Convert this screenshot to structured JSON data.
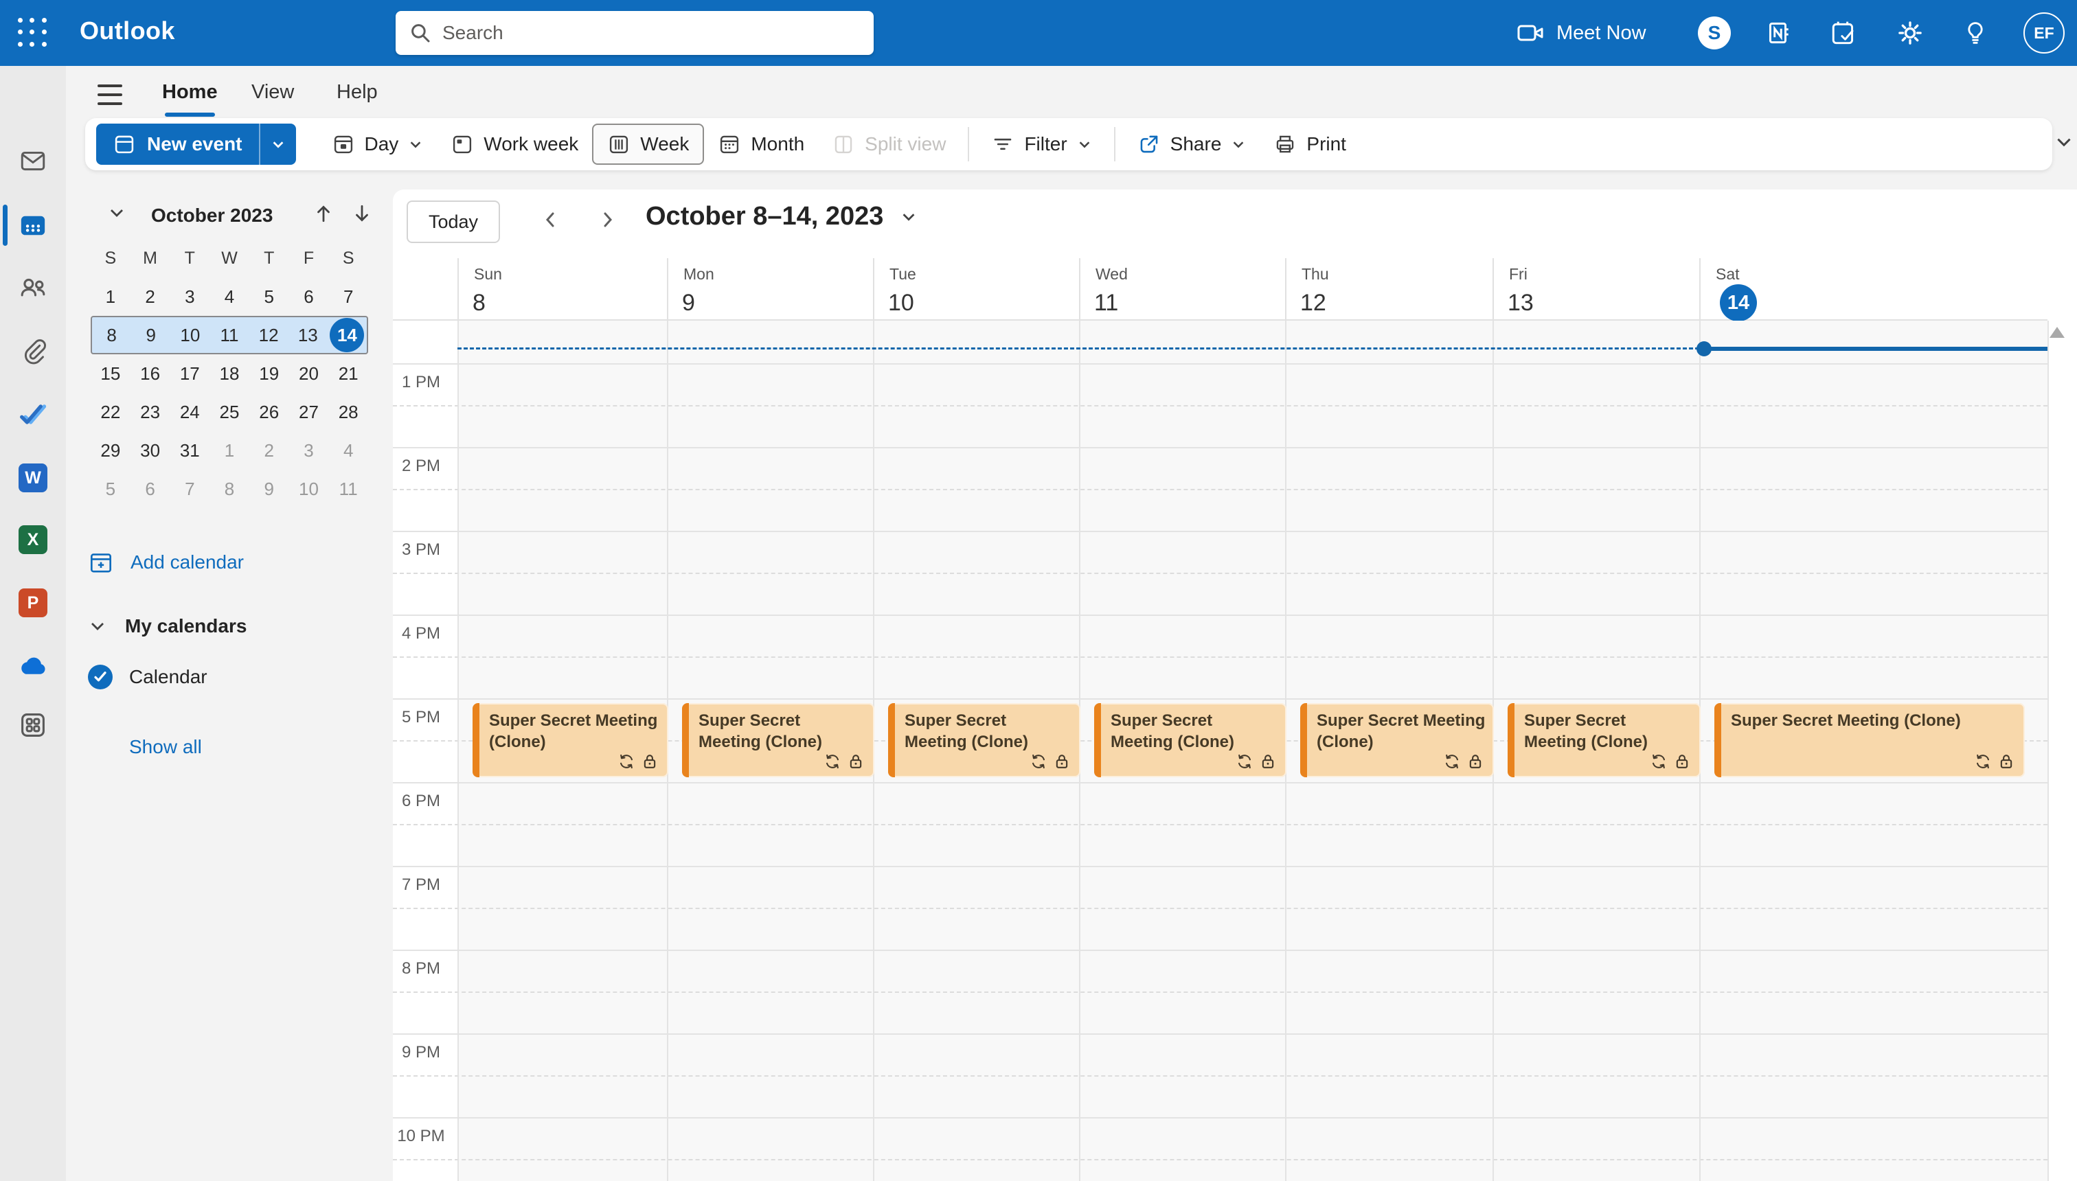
{
  "colors": {
    "accent": "#0f6cbd",
    "topbar": "#0f6cbd",
    "event_fill": "#f8d8ab",
    "event_bar": "#e9831d",
    "now_line": "#1266ab"
  },
  "topbar": {
    "app_name": "Outlook",
    "search_placeholder": "Search",
    "meet_now_label": "Meet Now",
    "avatar_initials": "EF"
  },
  "rail": {
    "items": [
      {
        "id": "mail"
      },
      {
        "id": "calendar",
        "selected": true
      },
      {
        "id": "people"
      },
      {
        "id": "attachments"
      },
      {
        "id": "todo"
      },
      {
        "id": "word"
      },
      {
        "id": "excel"
      },
      {
        "id": "powerpoint"
      },
      {
        "id": "onedrive"
      },
      {
        "id": "apps"
      }
    ],
    "office_letters": {
      "word": "W",
      "excel": "X",
      "powerpoint": "P"
    }
  },
  "ribbon": {
    "tabs": [
      {
        "label": "Home",
        "active": true
      },
      {
        "label": "View",
        "active": false
      },
      {
        "label": "Help",
        "active": false
      }
    ],
    "new_event_label": "New event",
    "view_buttons": [
      {
        "label": "Day",
        "chevron": true
      },
      {
        "label": "Work week"
      },
      {
        "label": "Week",
        "selected": true
      },
      {
        "label": "Month"
      },
      {
        "label": "Split view",
        "disabled": true
      }
    ],
    "filter_label": "Filter",
    "share_label": "Share",
    "print_label": "Print"
  },
  "sidebar": {
    "month_title": "October 2023",
    "weekdays": [
      "S",
      "M",
      "T",
      "W",
      "T",
      "F",
      "S"
    ],
    "weeks": [
      [
        {
          "d": 1
        },
        {
          "d": 2
        },
        {
          "d": 3
        },
        {
          "d": 4
        },
        {
          "d": 5
        },
        {
          "d": 6
        },
        {
          "d": 7
        }
      ],
      [
        {
          "d": 8
        },
        {
          "d": 9
        },
        {
          "d": 10
        },
        {
          "d": 11
        },
        {
          "d": 12
        },
        {
          "d": 13
        },
        {
          "d": 14
        }
      ],
      [
        {
          "d": 15
        },
        {
          "d": 16
        },
        {
          "d": 17
        },
        {
          "d": 18
        },
        {
          "d": 19
        },
        {
          "d": 20
        },
        {
          "d": 21
        }
      ],
      [
        {
          "d": 22
        },
        {
          "d": 23
        },
        {
          "d": 24
        },
        {
          "d": 25
        },
        {
          "d": 26
        },
        {
          "d": 27
        },
        {
          "d": 28
        }
      ],
      [
        {
          "d": 29
        },
        {
          "d": 30
        },
        {
          "d": 31
        },
        {
          "d": 1,
          "out": true
        },
        {
          "d": 2,
          "out": true
        },
        {
          "d": 3,
          "out": true
        },
        {
          "d": 4,
          "out": true
        }
      ],
      [
        {
          "d": 5,
          "out": true
        },
        {
          "d": 6,
          "out": true
        },
        {
          "d": 7,
          "out": true
        },
        {
          "d": 8,
          "out": true
        },
        {
          "d": 9,
          "out": true
        },
        {
          "d": 10,
          "out": true
        },
        {
          "d": 11,
          "out": true
        }
      ]
    ],
    "selected_week": 1,
    "selected_day": 14,
    "add_calendar_label": "Add calendar",
    "my_calendars_label": "My calendars",
    "calendars": [
      {
        "label": "Calendar",
        "checked": true
      }
    ],
    "show_all_label": "Show all"
  },
  "calendar": {
    "today_label": "Today",
    "title": "October 8–14, 2023",
    "days": [
      {
        "name": "Sun",
        "num": "8"
      },
      {
        "name": "Mon",
        "num": "9"
      },
      {
        "name": "Tue",
        "num": "10"
      },
      {
        "name": "Wed",
        "num": "11"
      },
      {
        "name": "Thu",
        "num": "12"
      },
      {
        "name": "Fri",
        "num": "13"
      },
      {
        "name": "Sat",
        "num": "14",
        "selected": true
      }
    ],
    "time_labels": [
      "1 PM",
      "2 PM",
      "3 PM",
      "4 PM",
      "5 PM",
      "6 PM",
      "7 PM",
      "8 PM",
      "9 PM",
      "10 PM"
    ],
    "events": [
      {
        "day_index": 0,
        "title": "Super Secret Meeting (Clone)",
        "start": "5 PM",
        "recurring": true,
        "private": true
      },
      {
        "day_index": 1,
        "title": "Super Secret Meeting (Clone)",
        "start": "5 PM",
        "recurring": true,
        "private": true
      },
      {
        "day_index": 2,
        "title": "Super Secret Meeting (Clone)",
        "start": "5 PM",
        "recurring": true,
        "private": true
      },
      {
        "day_index": 3,
        "title": "Super Secret Meeting (Clone)",
        "start": "5 PM",
        "recurring": true,
        "private": true
      },
      {
        "day_index": 4,
        "title": "Super Secret Meeting (Clone)",
        "start": "5 PM",
        "recurring": true,
        "private": true
      },
      {
        "day_index": 5,
        "title": "Super Secret Meeting (Clone)",
        "start": "5 PM",
        "recurring": true,
        "private": true
      },
      {
        "day_index": 6,
        "title": "Super Secret Meeting (Clone)",
        "start": "5 PM",
        "recurring": true,
        "private": true
      }
    ]
  }
}
